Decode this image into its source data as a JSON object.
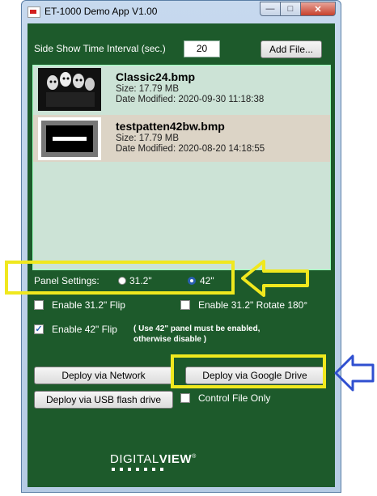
{
  "window": {
    "title": "ET-1000 Demo App V1.00"
  },
  "slideshow": {
    "label": "Side Show Time Interval (sec.)",
    "value": "20"
  },
  "buttons": {
    "add_file": "Add File...",
    "deploy_network": "Deploy via Network",
    "deploy_gdrive": "Deploy via Google Drive",
    "deploy_usb": "Deploy via USB flash drive"
  },
  "files": [
    {
      "name": "Classic24.bmp",
      "size": "Size: 17.79 MB",
      "date": "Date Modified: 2020-09-30 11:18:38",
      "selected": false
    },
    {
      "name": "testpatten42bw.bmp",
      "size": "Size: 17.79 MB",
      "date": "Date Modified: 2020-08-20 14:18:55",
      "selected": true
    }
  ],
  "panel": {
    "label": "Panel Settings:",
    "option_31": "31.2\"",
    "option_42": "42\"",
    "selected": "42\""
  },
  "checkboxes": {
    "flip_31": {
      "label": "Enable 31.2\" Flip",
      "checked": false
    },
    "rotate_31": {
      "label": "Enable 31.2\" Rotate 180°",
      "checked": false
    },
    "flip_42": {
      "label": "Enable 42\" Flip",
      "checked": true
    },
    "flip_42_note_1": "( Use 42\" panel must be enabled,",
    "flip_42_note_2": "otherwise disable )",
    "control_file_only": {
      "label": "Control File Only",
      "checked": false
    }
  },
  "logo": {
    "text_a": "DIGITAL",
    "text_b": "VIEW",
    "mark": "®"
  },
  "colors": {
    "client_bg": "#1d5a2b",
    "highlight": "#f0e81e",
    "arrow_blue": "#2f4fd0"
  }
}
